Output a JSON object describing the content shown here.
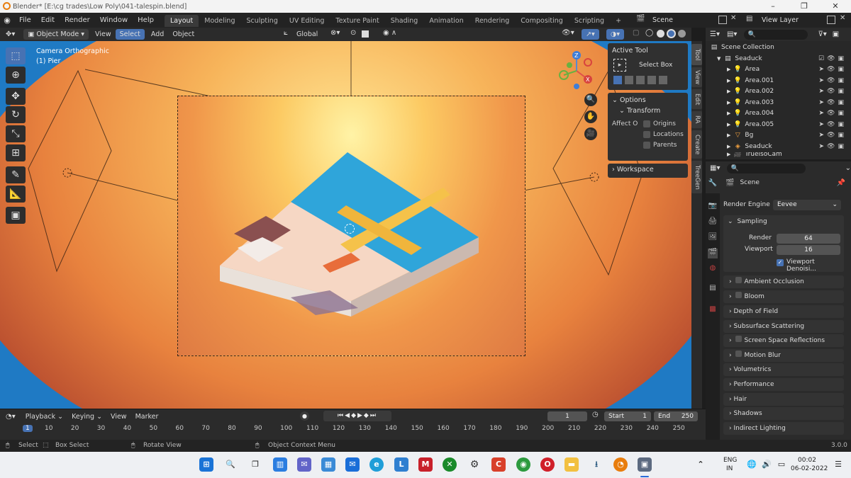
{
  "window": {
    "title": "Blender* [E:\\cg trades\\Low Poly\\041-talespin.blend]",
    "minimize": "–",
    "maximize": "❐",
    "close": "✕"
  },
  "menu": {
    "items": [
      "File",
      "Edit",
      "Render",
      "Window",
      "Help"
    ],
    "workspaces": [
      "Layout",
      "Modeling",
      "Sculpting",
      "UV Editing",
      "Texture Paint",
      "Shading",
      "Animation",
      "Rendering",
      "Compositing",
      "Scripting"
    ],
    "add_workspace": "+",
    "scene": "Scene",
    "view_layer": "View Layer"
  },
  "viewport_header": {
    "mode": "Object Mode",
    "view": "View",
    "select": "Select",
    "add": "Add",
    "object": "Object",
    "orientation": "Global"
  },
  "viewport": {
    "camera_label": "Camera Orthographic",
    "object_label": "(1) Pier"
  },
  "npanel": {
    "active_tool_title": "Active Tool",
    "select_box": "Select Box",
    "options_title": "Options",
    "transform_title": "Transform",
    "affect_only": "Affect O",
    "origins": "Origins",
    "locations": "Locations",
    "parents": "Parents",
    "workspace_title": "Workspace",
    "tabs": [
      "Tool",
      "View",
      "Edit",
      "RA",
      "Create",
      "TreeGen"
    ]
  },
  "outliner": {
    "scene_collection": "Scene Collection",
    "collection": "Seaduck",
    "items": [
      "Area",
      "Area.001",
      "Area.002",
      "Area.003",
      "Area.004",
      "Area.005",
      "Bg",
      "Seaduck",
      "TruelsoCam"
    ]
  },
  "properties": {
    "scene": "Scene",
    "render_engine_label": "Render Engine",
    "render_engine": "Eevee",
    "sampling": "Sampling",
    "render_label": "Render",
    "render_value": "64",
    "viewport_label": "Viewport",
    "viewport_value": "16",
    "viewport_denoise": "Viewport Denoisi...",
    "panels": [
      "Ambient Occlusion",
      "Bloom",
      "Depth of Field",
      "Subsurface Scattering",
      "Screen Space Reflections",
      "Motion Blur",
      "Volumetrics",
      "Performance",
      "Hair",
      "Shadows",
      "Indirect Lighting"
    ]
  },
  "timeline": {
    "playback": "Playback",
    "keying": "Keying",
    "view": "View",
    "marker": "Marker",
    "current_frame": "1",
    "start_label": "Start",
    "start_value": "1",
    "end_label": "End",
    "end_value": "250",
    "ticks": [
      "1",
      "10",
      "20",
      "30",
      "40",
      "50",
      "60",
      "70",
      "80",
      "90",
      "100",
      "110",
      "120",
      "130",
      "140",
      "150",
      "160",
      "170",
      "180",
      "190",
      "200",
      "210",
      "220",
      "230",
      "240",
      "250"
    ]
  },
  "statusbar": {
    "select": "Select",
    "box_select": "Box Select",
    "rotate_view": "Rotate View",
    "context_menu": "Object Context Menu",
    "version": "3.0.0"
  },
  "taskbar": {
    "lang": "ENG",
    "region": "IN",
    "time": "00:02",
    "date": "06-02-2022"
  }
}
